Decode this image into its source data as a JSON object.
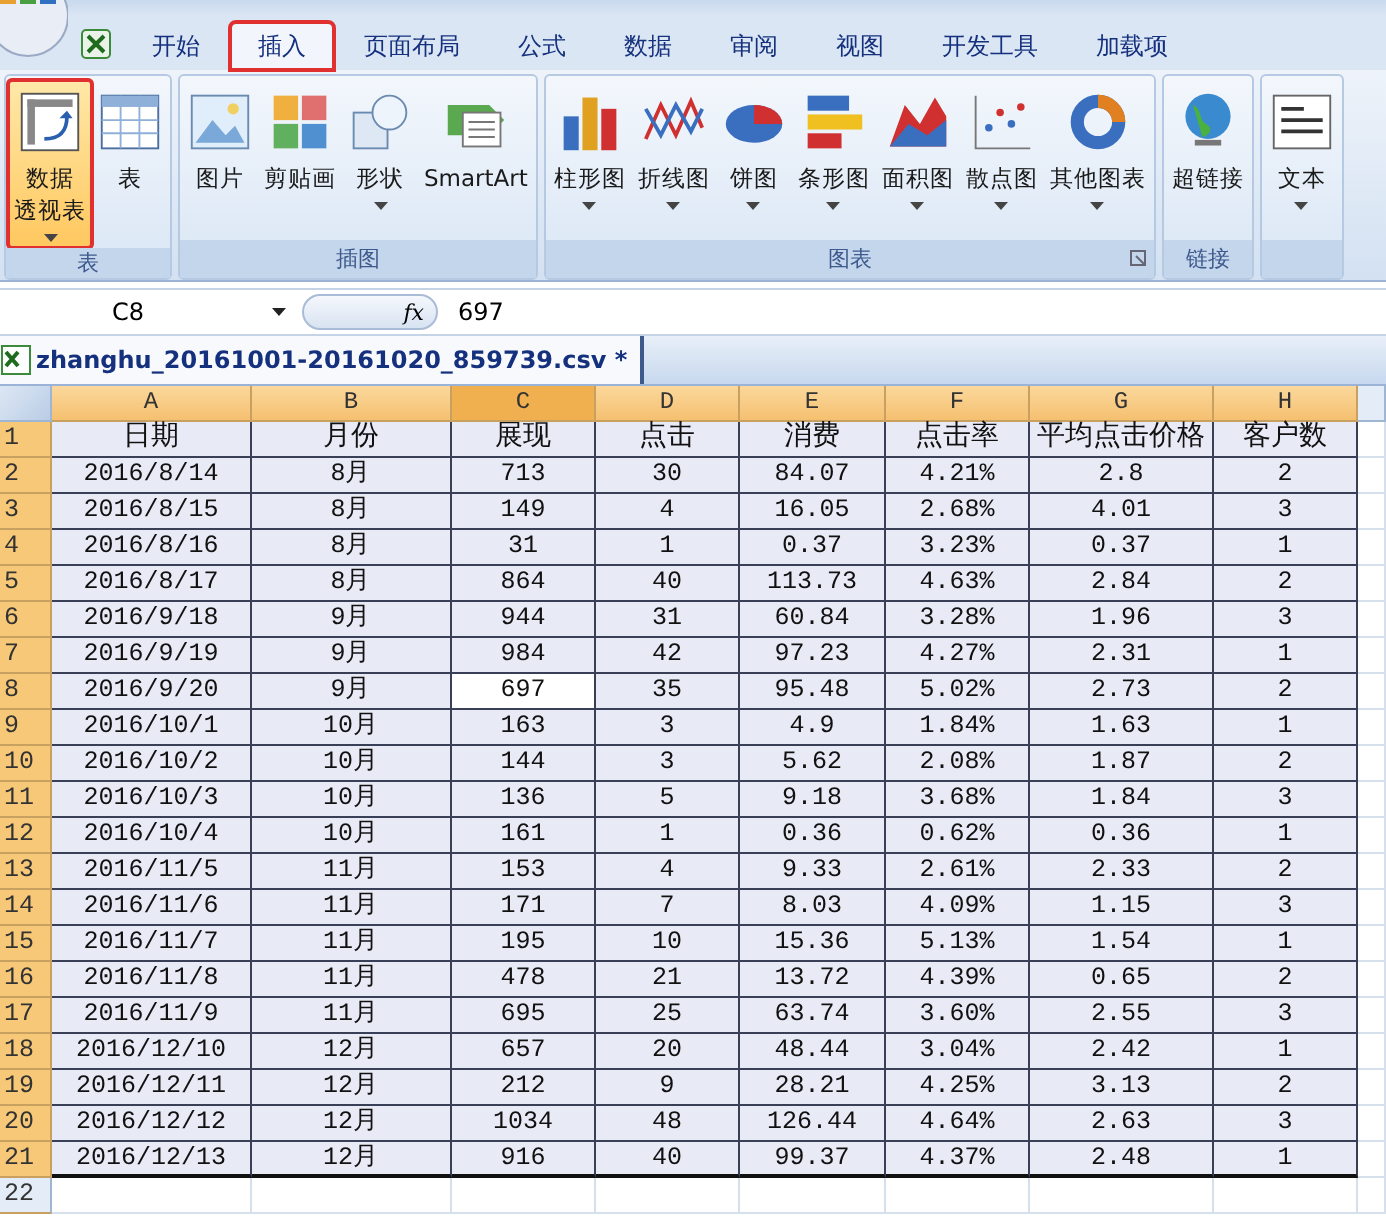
{
  "ribbon_tabs": [
    {
      "label": "开始",
      "selected": false,
      "highlighted": false
    },
    {
      "label": "插入",
      "selected": true,
      "highlighted": true
    },
    {
      "label": "页面布局",
      "selected": false,
      "highlighted": false
    },
    {
      "label": "公式",
      "selected": false,
      "highlighted": false
    },
    {
      "label": "数据",
      "selected": false,
      "highlighted": false
    },
    {
      "label": "审阅",
      "selected": false,
      "highlighted": false
    },
    {
      "label": "视图",
      "selected": false,
      "highlighted": false
    },
    {
      "label": "开发工具",
      "selected": false,
      "highlighted": false
    },
    {
      "label": "加载项",
      "selected": false,
      "highlighted": false
    }
  ],
  "ribbon_groups": [
    {
      "label": "表",
      "launcher": false,
      "buttons": [
        {
          "label": [
            "数据",
            "透视表"
          ],
          "dropdown": true,
          "highlighted": true
        },
        {
          "label": [
            "表"
          ],
          "dropdown": false,
          "highlighted": false
        }
      ]
    },
    {
      "label": "插图",
      "launcher": false,
      "buttons": [
        {
          "label": [
            "图片"
          ],
          "dropdown": false,
          "highlighted": false
        },
        {
          "label": [
            "剪贴画"
          ],
          "dropdown": false,
          "highlighted": false
        },
        {
          "label": [
            "形状"
          ],
          "dropdown": true,
          "highlighted": false
        },
        {
          "label": [
            "SmartArt"
          ],
          "dropdown": false,
          "highlighted": false
        }
      ]
    },
    {
      "label": "图表",
      "launcher": true,
      "buttons": [
        {
          "label": [
            "柱形图"
          ],
          "dropdown": true,
          "highlighted": false
        },
        {
          "label": [
            "折线图"
          ],
          "dropdown": true,
          "highlighted": false
        },
        {
          "label": [
            "饼图"
          ],
          "dropdown": true,
          "highlighted": false
        },
        {
          "label": [
            "条形图"
          ],
          "dropdown": true,
          "highlighted": false
        },
        {
          "label": [
            "面积图"
          ],
          "dropdown": true,
          "highlighted": false
        },
        {
          "label": [
            "散点图"
          ],
          "dropdown": true,
          "highlighted": false
        },
        {
          "label": [
            "其他图表"
          ],
          "dropdown": true,
          "highlighted": false
        }
      ]
    },
    {
      "label": "链接",
      "launcher": false,
      "buttons": [
        {
          "label": [
            "超链接"
          ],
          "dropdown": false,
          "highlighted": false
        }
      ]
    },
    {
      "launcher": false,
      "buttons": [
        {
          "label": [
            "文本"
          ],
          "dropdown": true,
          "highlighted": false
        }
      ]
    }
  ],
  "name_box": "C8",
  "function_label": "fx",
  "formula": "697",
  "workbook_tab": "zhanghu_20161001-20161020_859739.csv *",
  "columns": [
    {
      "label": "A",
      "selected": true,
      "active": false
    },
    {
      "label": "B",
      "selected": true,
      "active": false
    },
    {
      "label": "C",
      "selected": true,
      "active": true
    },
    {
      "label": "D",
      "selected": true,
      "active": false
    },
    {
      "label": "E",
      "selected": true,
      "active": false
    },
    {
      "label": "F",
      "selected": true,
      "active": false
    },
    {
      "label": "G",
      "selected": true,
      "active": false
    },
    {
      "label": "H",
      "selected": true,
      "active": false
    }
  ],
  "rows": [
    {
      "label": "1",
      "selected": true,
      "active": false,
      "cells": [
        "日期",
        "月份",
        "展现",
        "点击",
        "消费",
        "点击率",
        "平均点击价格",
        "客户数"
      ]
    },
    {
      "label": "2",
      "selected": true,
      "active": false,
      "cells": [
        "2016/8/14",
        "8月",
        "713",
        "30",
        "84.07",
        "4.21%",
        "2.8",
        "2"
      ]
    },
    {
      "label": "3",
      "selected": true,
      "active": false,
      "cells": [
        "2016/8/15",
        "8月",
        "149",
        "4",
        "16.05",
        "2.68%",
        "4.01",
        "3"
      ]
    },
    {
      "label": "4",
      "selected": true,
      "active": false,
      "cells": [
        "2016/8/16",
        "8月",
        "31",
        "1",
        "0.37",
        "3.23%",
        "0.37",
        "1"
      ]
    },
    {
      "label": "5",
      "selected": true,
      "active": false,
      "cells": [
        "2016/8/17",
        "8月",
        "864",
        "40",
        "113.73",
        "4.63%",
        "2.84",
        "2"
      ]
    },
    {
      "label": "6",
      "selected": true,
      "active": false,
      "cells": [
        "2016/9/18",
        "9月",
        "944",
        "31",
        "60.84",
        "3.28%",
        "1.96",
        "3"
      ]
    },
    {
      "label": "7",
      "selected": true,
      "active": false,
      "cells": [
        "2016/9/19",
        "9月",
        "984",
        "42",
        "97.23",
        "4.27%",
        "2.31",
        "1"
      ]
    },
    {
      "label": "8",
      "selected": true,
      "active": true,
      "cells": [
        "2016/9/20",
        "9月",
        "697",
        "35",
        "95.48",
        "5.02%",
        "2.73",
        "2"
      ]
    },
    {
      "label": "9",
      "selected": true,
      "active": false,
      "cells": [
        "2016/10/1",
        "10月",
        "163",
        "3",
        "4.9",
        "1.84%",
        "1.63",
        "1"
      ]
    },
    {
      "label": "10",
      "selected": true,
      "active": false,
      "cells": [
        "2016/10/2",
        "10月",
        "144",
        "3",
        "5.62",
        "2.08%",
        "1.87",
        "2"
      ]
    },
    {
      "label": "11",
      "selected": true,
      "active": false,
      "cells": [
        "2016/10/3",
        "10月",
        "136",
        "5",
        "9.18",
        "3.68%",
        "1.84",
        "3"
      ]
    },
    {
      "label": "12",
      "selected": true,
      "active": false,
      "cells": [
        "2016/10/4",
        "10月",
        "161",
        "1",
        "0.36",
        "0.62%",
        "0.36",
        "1"
      ]
    },
    {
      "label": "13",
      "selected": true,
      "active": false,
      "cells": [
        "2016/11/5",
        "11月",
        "153",
        "4",
        "9.33",
        "2.61%",
        "2.33",
        "2"
      ]
    },
    {
      "label": "14",
      "selected": true,
      "active": false,
      "cells": [
        "2016/11/6",
        "11月",
        "171",
        "7",
        "8.03",
        "4.09%",
        "1.15",
        "3"
      ]
    },
    {
      "label": "15",
      "selected": true,
      "active": false,
      "cells": [
        "2016/11/7",
        "11月",
        "195",
        "10",
        "15.36",
        "5.13%",
        "1.54",
        "1"
      ]
    },
    {
      "label": "16",
      "selected": true,
      "active": false,
      "cells": [
        "2016/11/8",
        "11月",
        "478",
        "21",
        "13.72",
        "4.39%",
        "0.65",
        "2"
      ]
    },
    {
      "label": "17",
      "selected": true,
      "active": false,
      "cells": [
        "2016/11/9",
        "11月",
        "695",
        "25",
        "63.74",
        "3.60%",
        "2.55",
        "3"
      ]
    },
    {
      "label": "18",
      "selected": true,
      "active": false,
      "cells": [
        "2016/12/10",
        "12月",
        "657",
        "20",
        "48.44",
        "3.04%",
        "2.42",
        "1"
      ]
    },
    {
      "label": "19",
      "selected": true,
      "active": false,
      "cells": [
        "2016/12/11",
        "12月",
        "212",
        "9",
        "28.21",
        "4.25%",
        "3.13",
        "2"
      ]
    },
    {
      "label": "20",
      "selected": true,
      "active": false,
      "cells": [
        "2016/12/12",
        "12月",
        "1034",
        "48",
        "126.44",
        "4.64%",
        "2.63",
        "3"
      ]
    },
    {
      "label": "21",
      "selected": true,
      "active": false,
      "cells": [
        "2016/12/13",
        "12月",
        "916",
        "40",
        "99.37",
        "4.37%",
        "2.48",
        "1"
      ]
    },
    {
      "label": "22",
      "selected": false,
      "active": false
    }
  ]
}
